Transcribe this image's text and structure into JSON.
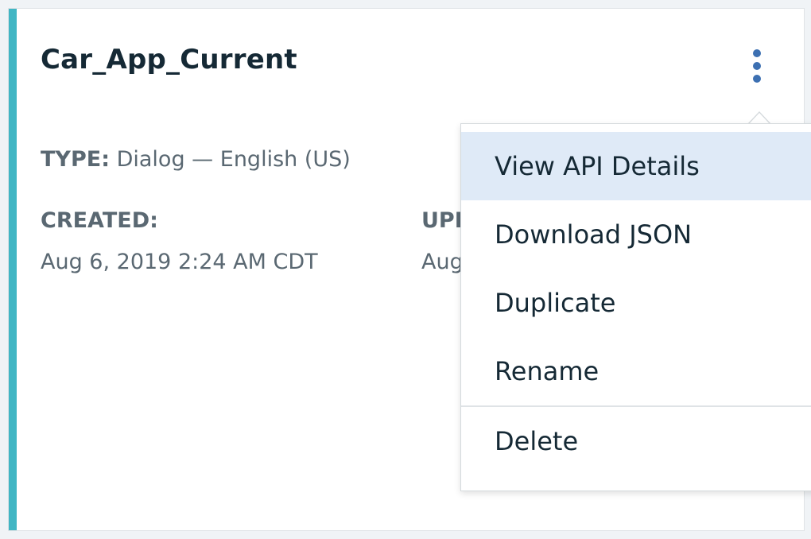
{
  "card": {
    "title": "Car_App_Current",
    "type_label": "TYPE:",
    "type_value": "Dialog — English (US)",
    "created_label": "CREATED:",
    "created_value": "Aug 6, 2019 2:24 AM CDT",
    "updated_label": "UPD",
    "updated_value": "Aug",
    "accent_color": "#41b6c4"
  },
  "overflow_menu": {
    "icon": "overflow-menu-vertical-icon",
    "items": [
      {
        "label": "View API Details",
        "highlighted": true
      },
      {
        "label": "Download JSON"
      },
      {
        "label": "Duplicate"
      },
      {
        "label": "Rename"
      },
      {
        "label": "Delete"
      }
    ]
  }
}
